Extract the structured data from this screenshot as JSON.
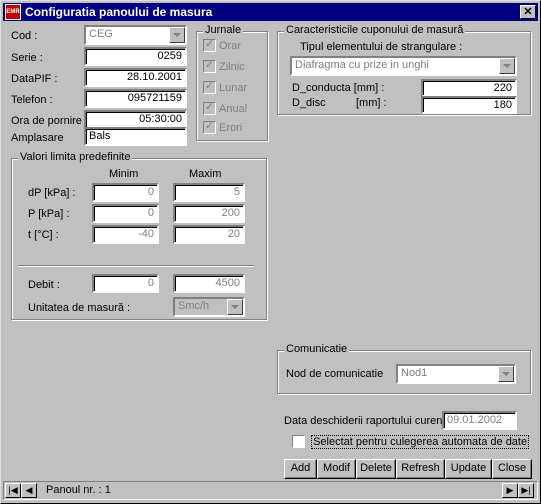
{
  "window": {
    "title": "Configuratia panoului de masura",
    "app_icon": "app-icon",
    "close_label": "✕"
  },
  "form": {
    "cod": {
      "label": "Cod :",
      "value": "CEG"
    },
    "serie": {
      "label": "Serie :",
      "value": "0259"
    },
    "datapif": {
      "label": "DataPIF :",
      "value": "28.10.2001"
    },
    "telefon": {
      "label": "Telefon :",
      "value": "095721159"
    },
    "ora": {
      "label": "Ora de pornire",
      "value": "05:30:00"
    },
    "amplasare": {
      "label": "Amplasare",
      "value": "Bals"
    }
  },
  "jurnale": {
    "title": "Jurnale",
    "items": [
      {
        "label": "Orar",
        "checked": true
      },
      {
        "label": "Zilnic",
        "checked": true
      },
      {
        "label": "Lunar",
        "checked": true
      },
      {
        "label": "Anual",
        "checked": true
      },
      {
        "label": "Erori",
        "checked": true
      }
    ]
  },
  "cupon": {
    "title": "Caracteristicile cuponului de masură",
    "tip_label": "Tipul elementului de strangulare :",
    "tip_value": "Diafragma cu prize in unghi",
    "d_conducta_label": "D_conducta [mm] :",
    "d_conducta_value": "220",
    "d_disc_label": "D_disc",
    "d_disc_unit": "[mm] :",
    "d_disc_value": "180"
  },
  "limite": {
    "title": "Valori limita predefinite",
    "min_header": "Minim",
    "max_header": "Maxim",
    "rows": [
      {
        "label": "dP  [kPa] :",
        "min": "0",
        "max": "5"
      },
      {
        "label": "P   [kPa] :",
        "min": "0",
        "max": "200"
      },
      {
        "label": "t     [°C] :",
        "min": "-40",
        "max": "20"
      }
    ],
    "debit": {
      "label": "Debit :",
      "min": "0",
      "max": "4500"
    },
    "unitate": {
      "label": "Unitatea de masură :",
      "value": "Smc/h"
    }
  },
  "comunicatie": {
    "title": "Comunicatie",
    "nod_label": "Nod de comunicatie",
    "nod_value": "Nod1"
  },
  "raport": {
    "label": "Data deschiderii raportului curent:",
    "value": "09.01.2002",
    "auto_label": "Selectat pentru culegerea automata de date"
  },
  "buttons": {
    "add": "Add",
    "modif": "Modif",
    "delete": "Delete",
    "refresh": "Refresh",
    "update": "Update",
    "close": "Close"
  },
  "nav": {
    "label": "Panoul nr. : 1"
  }
}
